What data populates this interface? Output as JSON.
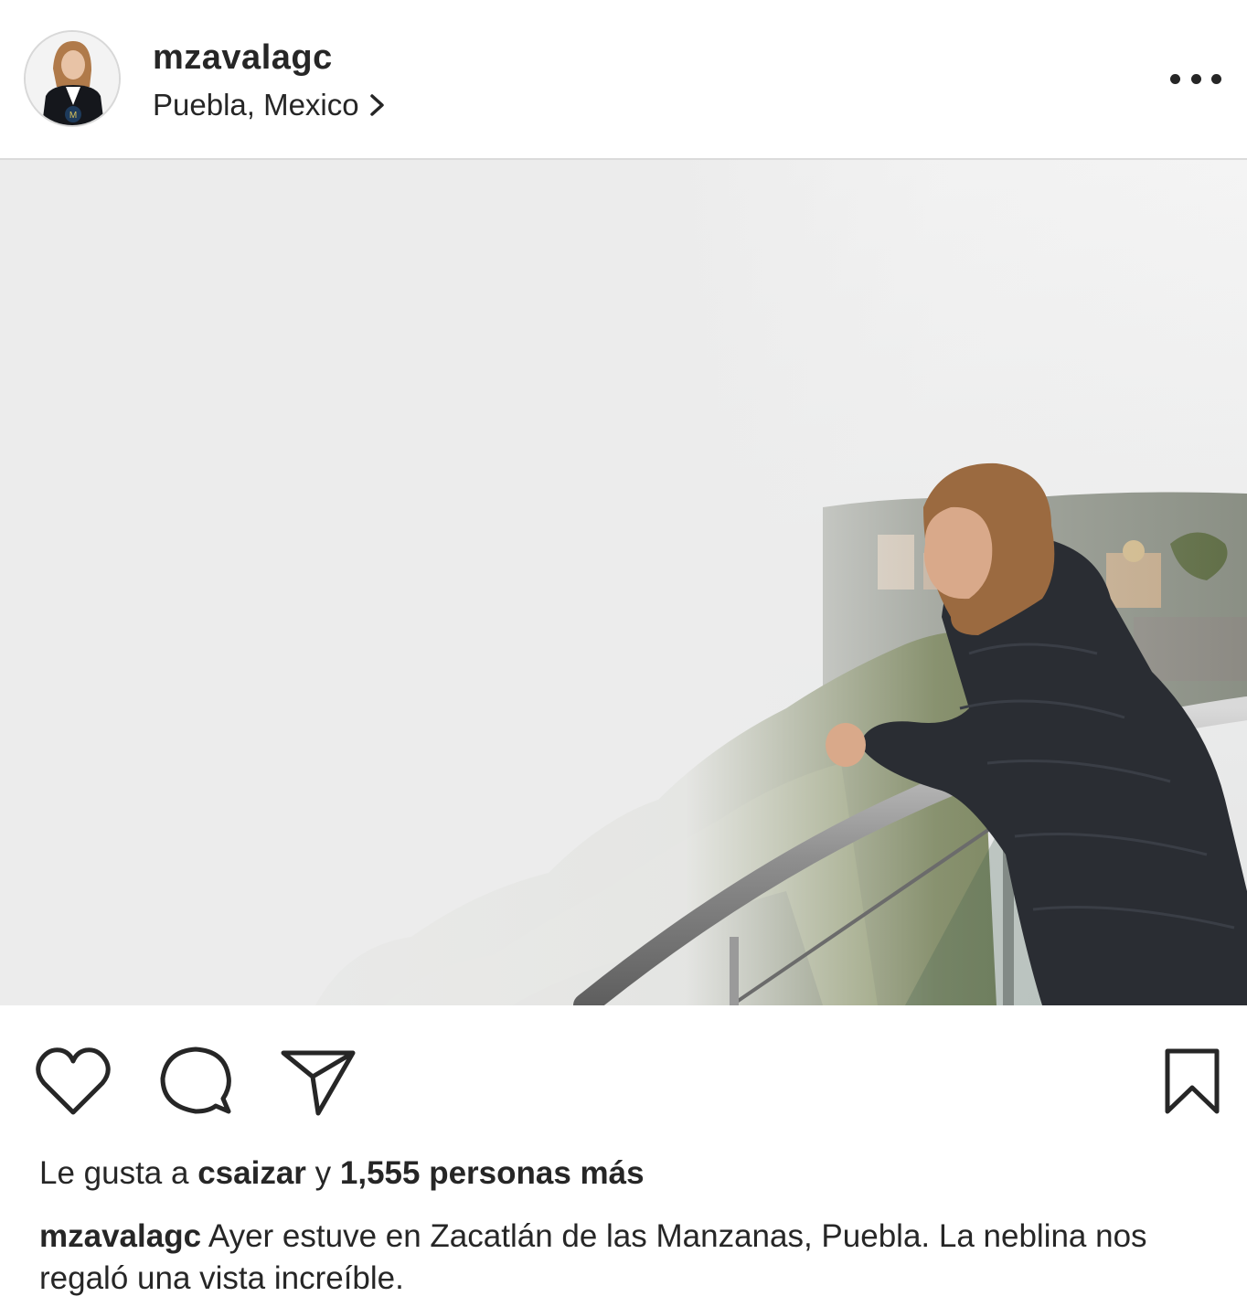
{
  "post": {
    "username": "mzavalagc",
    "location": "Puebla, Mexico",
    "avatar_badge": "M"
  },
  "icons": {
    "like": "heart-icon",
    "comment": "comment-bubble-icon",
    "share": "paper-plane-icon",
    "save": "bookmark-icon",
    "more": "more-options-icon",
    "location_arrow": "chevron-right-icon"
  },
  "likes": {
    "prefix": "Le gusta a",
    "user": "csaizar",
    "joiner": "y",
    "count_text": "1,555 personas más"
  },
  "caption": {
    "username": "mzavalagc",
    "text": "Ayer estuve en Zacatlán de las Manzanas, Puebla. La neblina nos regaló una vista increíble."
  },
  "colors": {
    "text": "#262626",
    "divider": "#dbdbdb",
    "fog": "#e9eaea",
    "foliage": "#5e6b3a",
    "jacket": "#2a2d33"
  }
}
